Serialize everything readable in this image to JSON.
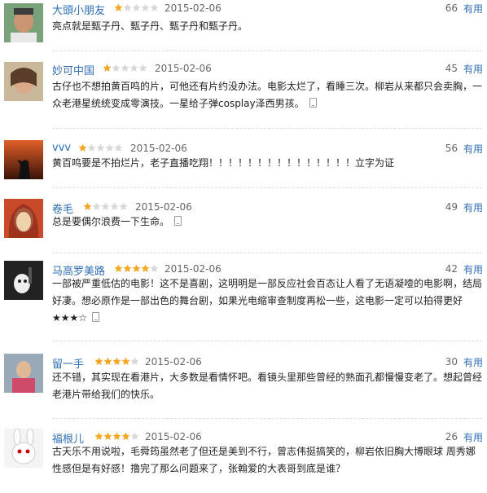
{
  "reviews": [
    {
      "user": "大頭小朋友",
      "rating": 1,
      "date": "2015-02-06",
      "votes": "66",
      "useful": "有用",
      "text": "亮点就是甄子丹、甄子丹、甄子丹和甄子丹。",
      "mobile": false
    },
    {
      "user": "妙可中国",
      "rating": 1,
      "date": "2015-02-06",
      "votes": "45",
      "useful": "有用",
      "text": "古仔也不想拍黄百鸣的片，可他还有片约没办法。电影太烂了，看睡三次。柳岩从来都只会卖胸，一众老港星统统变成零演技。一星给子弹cosplay泽西男孩。",
      "mobile": true
    },
    {
      "user": "vvv",
      "rating": 1,
      "date": "2015-02-06",
      "votes": "56",
      "useful": "有用",
      "text": "黄百鸣要是不拍烂片，老子直播吃翔！！！！！！！！！！！！！！！立字为证",
      "mobile": false
    },
    {
      "user": "卷毛",
      "rating": 1,
      "date": "2015-02-06",
      "votes": "49",
      "useful": "有用",
      "text": "总是要偶尔浪费一下生命。",
      "mobile": true
    },
    {
      "user": "马高罗美路",
      "rating": 4,
      "date": "2015-02-06",
      "votes": "42",
      "useful": "有用",
      "text": "一部被严重低估的电影！这不是喜剧，这明明是一部反应社会百态让人看了无语凝噎的电影啊，结局好凄。想必原作是一部出色的舞台剧，如果光电缩审查制度再松一些，这电影一定可以拍得更好★★★☆",
      "mobile": true
    },
    {
      "user": "留一手",
      "rating": 4,
      "date": "2015-02-06",
      "votes": "30",
      "useful": "有用",
      "text": "还不错，其实现在看港片，大多数是看情怀吧。看镜头里那些曾经的熟面孔都慢慢变老了。想起曾经老港片带给我们的快乐。",
      "mobile": false
    },
    {
      "user": "福根儿",
      "rating": 4,
      "date": "2015-02-06",
      "votes": "26",
      "useful": "有用",
      "text": "古天乐不用说啦，毛舜筠虽然老了但还是美到不行，曾志伟挺搞笑的，柳岩依旧胸大博眼球 周秀娜性感但是有好感！撸完了那么问题来了，张翰爱的大表哥到底是谁？",
      "mobile": false
    }
  ],
  "colors": {
    "link": "#2f6eb4",
    "star_on": "#f5a623",
    "star_off": "#d8d8d8"
  }
}
